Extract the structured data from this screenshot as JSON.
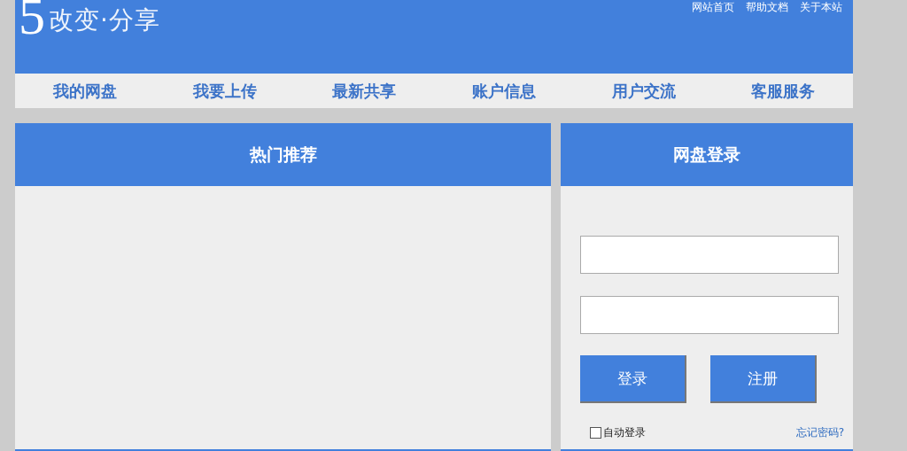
{
  "header": {
    "logo_mark": "5",
    "logo_text": "改变·分享",
    "links": [
      "网站首页",
      "帮助文档",
      "关于本站"
    ]
  },
  "nav": [
    "我的网盘",
    "我要上传",
    "最新共享",
    "账户信息",
    "用户交流",
    "客服服务"
  ],
  "hot_panel": {
    "title": "热门推荐"
  },
  "login_panel": {
    "title": "网盘登录",
    "buttons": [
      "登录",
      "注册"
    ],
    "auto_login": {
      "label": "自动登录",
      "checked": false
    },
    "forgot_link": "忘记密码?"
  }
}
